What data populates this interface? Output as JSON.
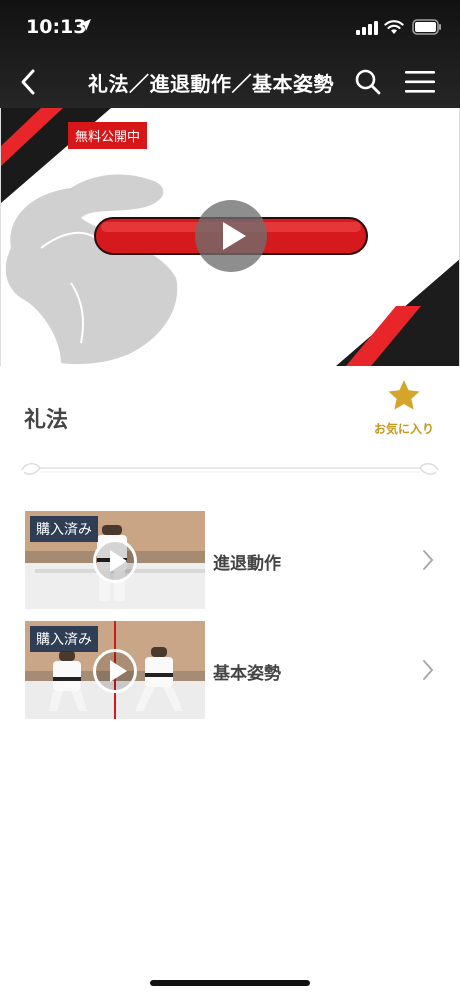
{
  "status": {
    "time": "10:13"
  },
  "nav": {
    "title": "礼法／進退動作／基本姿勢"
  },
  "hero": {
    "badge": "無料公開中"
  },
  "section": {
    "title": "礼法",
    "favorite_label": "お気に入り"
  },
  "videos": [
    {
      "tag": "購入済み",
      "title": "進退動作"
    },
    {
      "tag": "購入済み",
      "title": "基本姿勢"
    }
  ],
  "colors": {
    "accent_red": "#d71618",
    "favorite_gold": "#d4a52a",
    "nav_bg": "#1c1c1c"
  }
}
